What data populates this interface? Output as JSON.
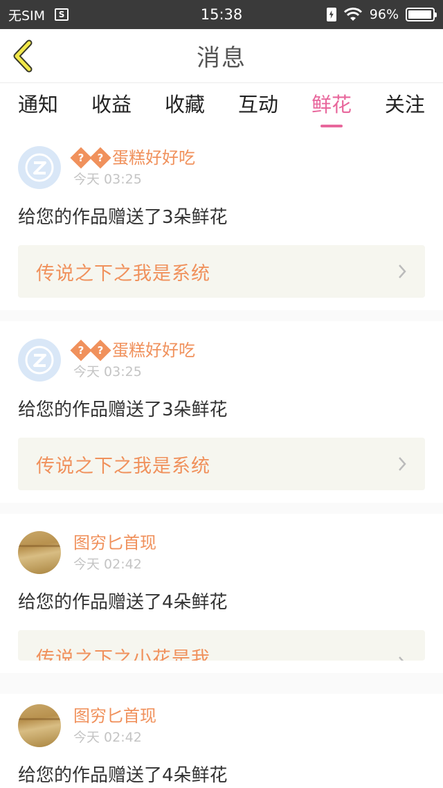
{
  "status_bar": {
    "carrier": "无SIM",
    "sim_icon_label": "S",
    "time": "15:38",
    "battery": "96%",
    "battery_level": 0.96
  },
  "header": {
    "title": "消息"
  },
  "tabs": [
    {
      "label": "通知",
      "active": false
    },
    {
      "label": "收益",
      "active": false
    },
    {
      "label": "收藏",
      "active": false
    },
    {
      "label": "互动",
      "active": false
    },
    {
      "label": "鲜花",
      "active": true
    },
    {
      "label": "关注",
      "active": false
    }
  ],
  "feed": [
    {
      "username": "蛋糕好好吃",
      "time": "今天 03:25",
      "message": "给您的作品赠送了3朵鲜花",
      "work_title": "传说之下之我是系统",
      "avatar": "default-avatar"
    },
    {
      "username": "蛋糕好好吃",
      "time": "今天 03:25",
      "message": "给您的作品赠送了3朵鲜花",
      "work_title": "传说之下之我是系统",
      "avatar": "default-avatar"
    },
    {
      "username": "图穷匕首现",
      "time": "今天 02:42",
      "message": "给您的作品赠送了4朵鲜花",
      "work_title": "传说之下之小花是我",
      "avatar": "photo-avatar"
    },
    {
      "username": "图穷匕首现",
      "time": "今天 02:42",
      "message": "给您的作品赠送了4朵鲜花",
      "avatar": "photo-avatar"
    }
  ],
  "colors": {
    "accent_pink": "#e8679c",
    "username_orange": "#f0915c",
    "status_bar_bg": "#3a3a3a"
  }
}
